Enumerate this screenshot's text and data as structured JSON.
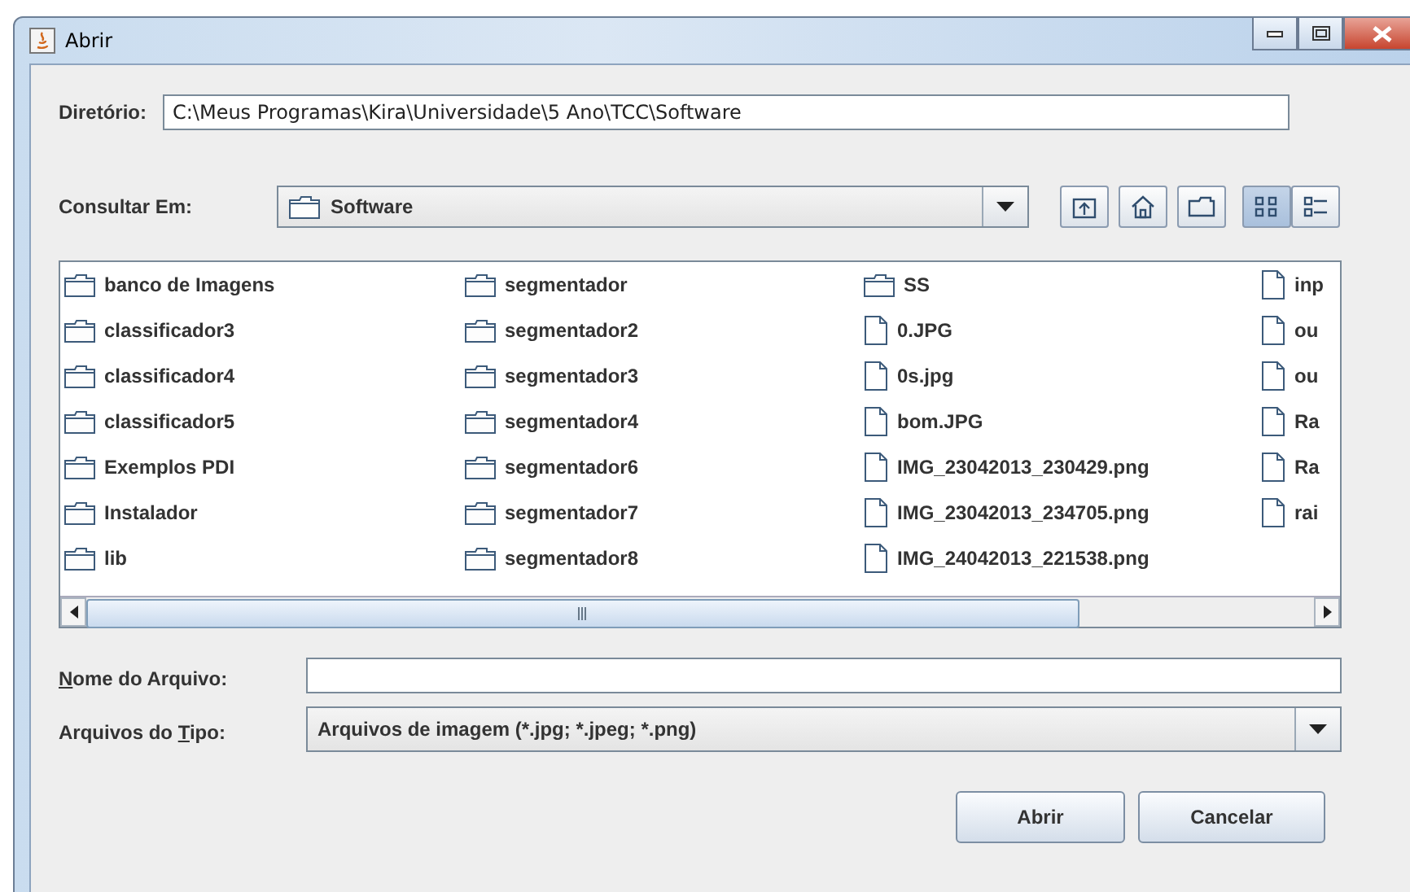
{
  "window": {
    "title": "Abrir"
  },
  "directory": {
    "label": "Diretório:",
    "value": "C:\\Meus Programas\\Kira\\Universidade\\5 Ano\\TCC\\Software"
  },
  "look_in": {
    "label": "Consultar Em:",
    "value": "Software"
  },
  "toolbar": [
    {
      "kind": "up"
    },
    {
      "kind": "home"
    },
    {
      "kind": "new-folder"
    },
    {
      "kind": "list",
      "selected": true
    },
    {
      "kind": "details",
      "selected": false
    }
  ],
  "files": [
    [
      {
        "name": "banco de Imagens",
        "kind": "folder"
      },
      {
        "name": "classificador3",
        "kind": "folder"
      },
      {
        "name": "classificador4",
        "kind": "folder"
      },
      {
        "name": "classificador5",
        "kind": "folder"
      },
      {
        "name": "Exemplos PDI",
        "kind": "folder"
      },
      {
        "name": "Instalador",
        "kind": "folder"
      },
      {
        "name": "lib",
        "kind": "folder"
      }
    ],
    [
      {
        "name": "segmentador",
        "kind": "folder"
      },
      {
        "name": "segmentador2",
        "kind": "folder"
      },
      {
        "name": "segmentador3",
        "kind": "folder"
      },
      {
        "name": "segmentador4",
        "kind": "folder"
      },
      {
        "name": "segmentador6",
        "kind": "folder"
      },
      {
        "name": "segmentador7",
        "kind": "folder"
      },
      {
        "name": "segmentador8",
        "kind": "folder"
      }
    ],
    [
      {
        "name": "SS",
        "kind": "folder"
      },
      {
        "name": "0.JPG",
        "kind": "file"
      },
      {
        "name": "0s.jpg",
        "kind": "file"
      },
      {
        "name": "bom.JPG",
        "kind": "file"
      },
      {
        "name": "IMG_23042013_230429.png",
        "kind": "file"
      },
      {
        "name": "IMG_23042013_234705.png",
        "kind": "file"
      },
      {
        "name": "IMG_24042013_221538.png",
        "kind": "file"
      }
    ],
    [
      {
        "name": "inp",
        "kind": "file"
      },
      {
        "name": "ou",
        "kind": "file"
      },
      {
        "name": "ou",
        "kind": "file"
      },
      {
        "name": "Ra",
        "kind": "file"
      },
      {
        "name": "Ra",
        "kind": "file"
      },
      {
        "name": "rai",
        "kind": "file"
      }
    ]
  ],
  "file_name": {
    "label": {
      "key": "N",
      "after": "ome do Arquivo:"
    }
  },
  "file_type": {
    "label": {
      "before": "Arquivos do ",
      "key": "T",
      "after": "ipo:"
    },
    "value": "Arquivos de imagem (*.jpg; *.jpeg; *.png)"
  },
  "buttons": [
    "Abrir",
    "Cancelar"
  ]
}
